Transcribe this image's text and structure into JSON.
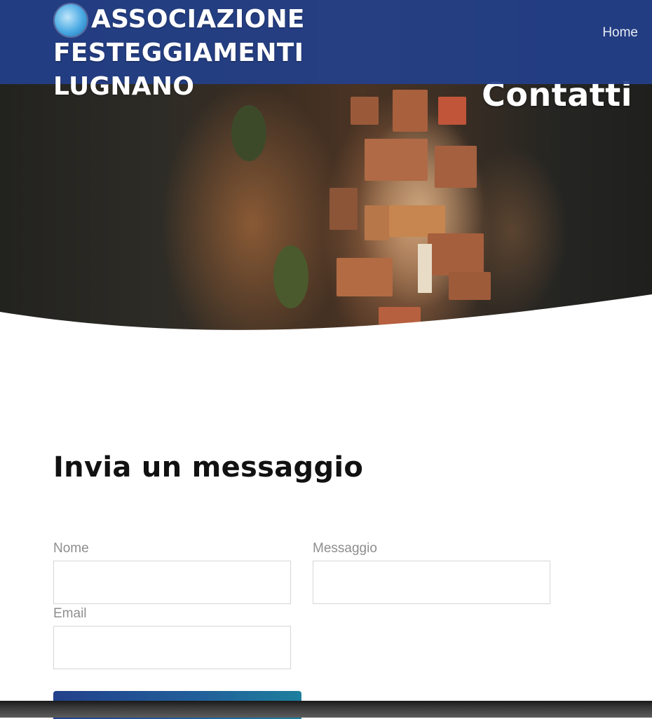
{
  "header": {
    "brand_line1": "ASSOCIAZIONE FESTEGGIAMENTI",
    "brand_line2": "LUGNANO",
    "logo_icon": "association-logo-icon",
    "nav": {
      "home": "Home"
    },
    "background_color": "#24408a"
  },
  "hero": {
    "title": "Contatti"
  },
  "form": {
    "heading": "Invia un messaggio",
    "fields": {
      "name_label": "Nome",
      "name_value": "",
      "email_label": "Email",
      "email_value": "",
      "message_label": "Messaggio",
      "message_value": ""
    },
    "submit_label": ""
  },
  "colors": {
    "accent": "#24408a",
    "button_gradient_end": "#1e7f9d",
    "label": "#8e8e8e"
  }
}
